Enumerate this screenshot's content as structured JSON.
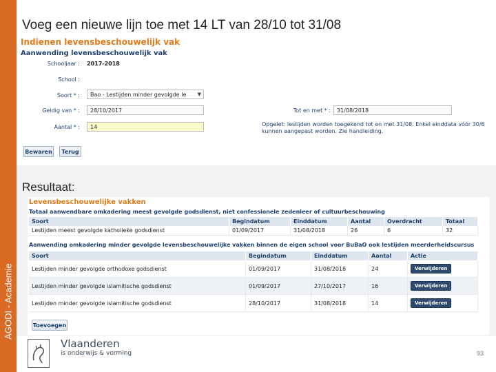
{
  "slide": {
    "title": "Voeg een nieuwe lijn toe met 14 LT van 28/10 tot 31/08",
    "side_label": "AGODI - Academie",
    "result_label": "Resultaat:",
    "page_number": "93"
  },
  "form": {
    "heading": "Indienen levensbeschouwelijk vak",
    "subheading": "Aanwending levensbeschouwelijk vak",
    "schooljaar_label": "Schooljaar :",
    "schooljaar_value": "2017-2018",
    "school_label": "School :",
    "school_value": "",
    "soort_label": "Soort * :",
    "soort_value": "Bao - Lestijden minder gevolgde le",
    "geldig_label": "Geldig van * :",
    "geldig_value": "28/10/2017",
    "aantal_label": "Aantal * :",
    "aantal_value": "14",
    "tot_label": "Tot en met * :",
    "tot_value": "31/08/2018",
    "note_line1": "Opgelet: lestijden worden toegekend tot en met 31/08. Enkel einddata vóór 30/6",
    "note_line2": "kunnen aangepast worden. Zie handleiding.",
    "save_button": "Bewaren",
    "back_button": "Terug"
  },
  "result": {
    "heading": "Levensbeschouwelijke vakken",
    "table1_title": "Totaal aanwendbare omkadering meest gevolgde godsdienst, niet confessionele zedenleer of cultuurbeschouwing",
    "table1_headers": [
      "Soort",
      "Begindatum",
      "Einddatum",
      "Aantal",
      "Overdracht",
      "Totaal"
    ],
    "table1_row": [
      "Lestijden meest gevolgde katholieke godsdienst",
      "01/09/2017",
      "31/08/2018",
      "26",
      "6",
      "32"
    ],
    "table2_title": "Aanwending omkadering minder gevolgde levensbeschouwelijke vakken binnen de eigen school voor BuBaO ook lestijden meerderheidscursus",
    "table2_headers": [
      "Soort",
      "Begindatum",
      "Einddatum",
      "Aantal",
      "Actie"
    ],
    "table2_rows": [
      [
        "Lestijden minder gevolgde orthodoxe godsdienst",
        "01/09/2017",
        "31/08/2018",
        "24",
        "Verwijderen"
      ],
      [
        "Lestijden minder gevolgde islamitische godsdienst",
        "01/09/2017",
        "27/10/2017",
        "16",
        "Verwijderen"
      ],
      [
        "Lestijden minder gevolgde islamitische godsdienst",
        "28/10/2017",
        "31/08/2018",
        "14",
        "Verwijderen"
      ]
    ],
    "add_button": "Toevoegen"
  },
  "footer": {
    "logo_name": "Vlaanderen",
    "logo_sub": "is onderwijs & vorming"
  },
  "colors": {
    "sidebar": "#d86a23",
    "heading_orange": "#e07b1a",
    "label_blue": "#1e3f6e",
    "button_dark": "#2e4a6e"
  }
}
